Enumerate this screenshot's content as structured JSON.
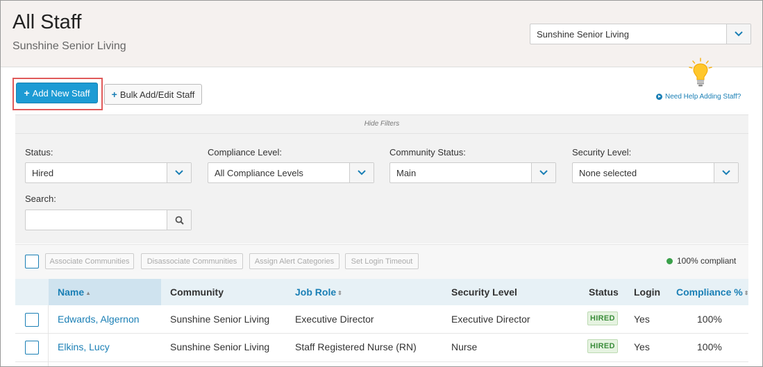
{
  "header": {
    "title": "All Staff",
    "subtitle": "Sunshine Senior Living",
    "community_select": "Sunshine Senior Living"
  },
  "toolbar": {
    "add_staff_label": "Add New Staff",
    "bulk_label": "Bulk Add/Edit Staff",
    "help_label": "Need Help Adding Staff?"
  },
  "filters": {
    "hide_label": "Hide Filters",
    "status_label": "Status:",
    "status_value": "Hired",
    "compliance_label": "Compliance Level:",
    "compliance_value": "All Compliance Levels",
    "community_status_label": "Community Status:",
    "community_status_value": "Main",
    "security_label": "Security Level:",
    "security_value": "None selected",
    "search_label": "Search:",
    "search_value": ""
  },
  "actions": {
    "associate": "Associate Communities",
    "disassociate": "Disassociate Communities",
    "assign_alert": "Assign Alert Categories",
    "set_timeout": "Set Login Timeout",
    "compliant": "100% compliant"
  },
  "table": {
    "columns": [
      "Name",
      "Community",
      "Job Role",
      "Security Level",
      "Status",
      "Login",
      "Compliance %"
    ],
    "rows": [
      {
        "name": "Edwards, Algernon",
        "community": "Sunshine Senior Living",
        "job_role": "Executive Director",
        "security": "Executive Director",
        "status": "HIRED",
        "login": "Yes",
        "compliance": "100%"
      },
      {
        "name": "Elkins, Lucy",
        "community": "Sunshine Senior Living",
        "job_role": "Staff Registered Nurse (RN)",
        "security": "Nurse",
        "status": "HIRED",
        "login": "Yes",
        "compliance": "100%"
      }
    ]
  },
  "colors": {
    "primary": "#1d9bd4",
    "link": "#1a7fb5",
    "header_bg": "#f5f1ef",
    "status_green": "#3b8d3b",
    "highlight_border": "#e05a5a"
  },
  "icons": [
    "chevron-down-icon",
    "plus-icon",
    "lightbulb-icon",
    "play-circle-icon",
    "search-icon",
    "sort-icon"
  ]
}
